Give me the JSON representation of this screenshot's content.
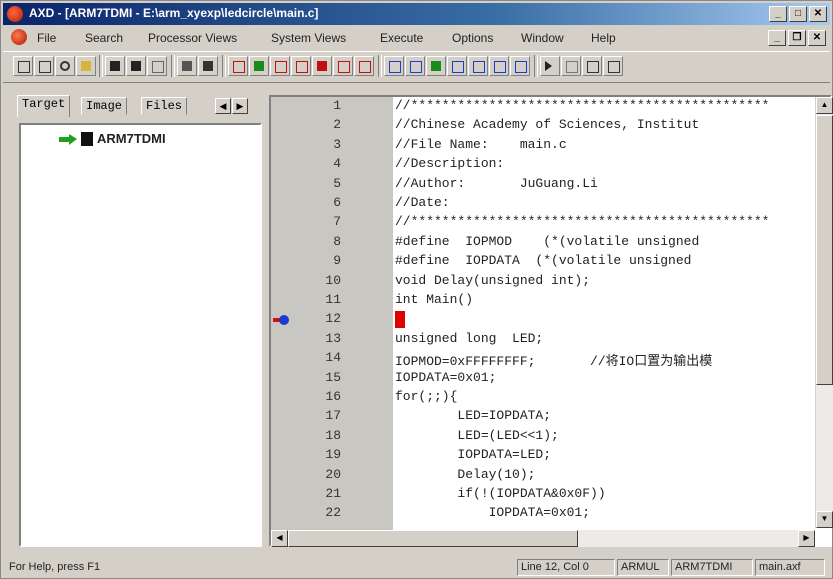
{
  "window": {
    "title": "AXD - [ARM7TDMI - E:\\arm_xyexp\\ledcircle\\main.c]"
  },
  "menus": [
    "File",
    "Search",
    "Processor Views",
    "System Views",
    "Execute",
    "Options",
    "Window",
    "Help"
  ],
  "tabs": [
    "Target",
    "Image",
    "Files"
  ],
  "tree": {
    "root_label": "ARM7TDMI"
  },
  "editor": {
    "current_line": 12,
    "lines": [
      {
        "n": "1",
        "code": "//**********************************************"
      },
      {
        "n": "2",
        "code": "//Chinese Academy of Sciences, Institut"
      },
      {
        "n": "3",
        "code": "//File Name:    main.c"
      },
      {
        "n": "4",
        "code": "//Description:"
      },
      {
        "n": "5",
        "code": "//Author:       JuGuang.Li"
      },
      {
        "n": "6",
        "code": "//Date:"
      },
      {
        "n": "7",
        "code": "//**********************************************"
      },
      {
        "n": "8",
        "code": "#define  IOPMOD    (*(volatile unsigned"
      },
      {
        "n": "9",
        "code": "#define  IOPDATA  (*(volatile unsigned"
      },
      {
        "n": "10",
        "code": "void Delay(unsigned int);"
      },
      {
        "n": "11",
        "code": "int Main()"
      },
      {
        "n": "12",
        "code": ""
      },
      {
        "n": "13",
        "code": "unsigned long  LED;"
      },
      {
        "n": "14",
        "code": "IOPMOD=0xFFFFFFFF;       //将IO口置为输出模"
      },
      {
        "n": "15",
        "code": "IOPDATA=0x01;"
      },
      {
        "n": "16",
        "code": "for(;;){"
      },
      {
        "n": "17",
        "code": "        LED=IOPDATA;"
      },
      {
        "n": "18",
        "code": "        LED=(LED<<1);"
      },
      {
        "n": "19",
        "code": "        IOPDATA=LED;"
      },
      {
        "n": "20",
        "code": "        Delay(10);"
      },
      {
        "n": "21",
        "code": "        if(!(IOPDATA&0x0F))"
      },
      {
        "n": "22",
        "code": "            IOPDATA=0x01;"
      }
    ]
  },
  "status": {
    "help": "For Help, press F1",
    "position": "Line 12, Col 0",
    "mode": "ARMUL",
    "target": "ARM7TDMI",
    "image": "main.axf"
  }
}
